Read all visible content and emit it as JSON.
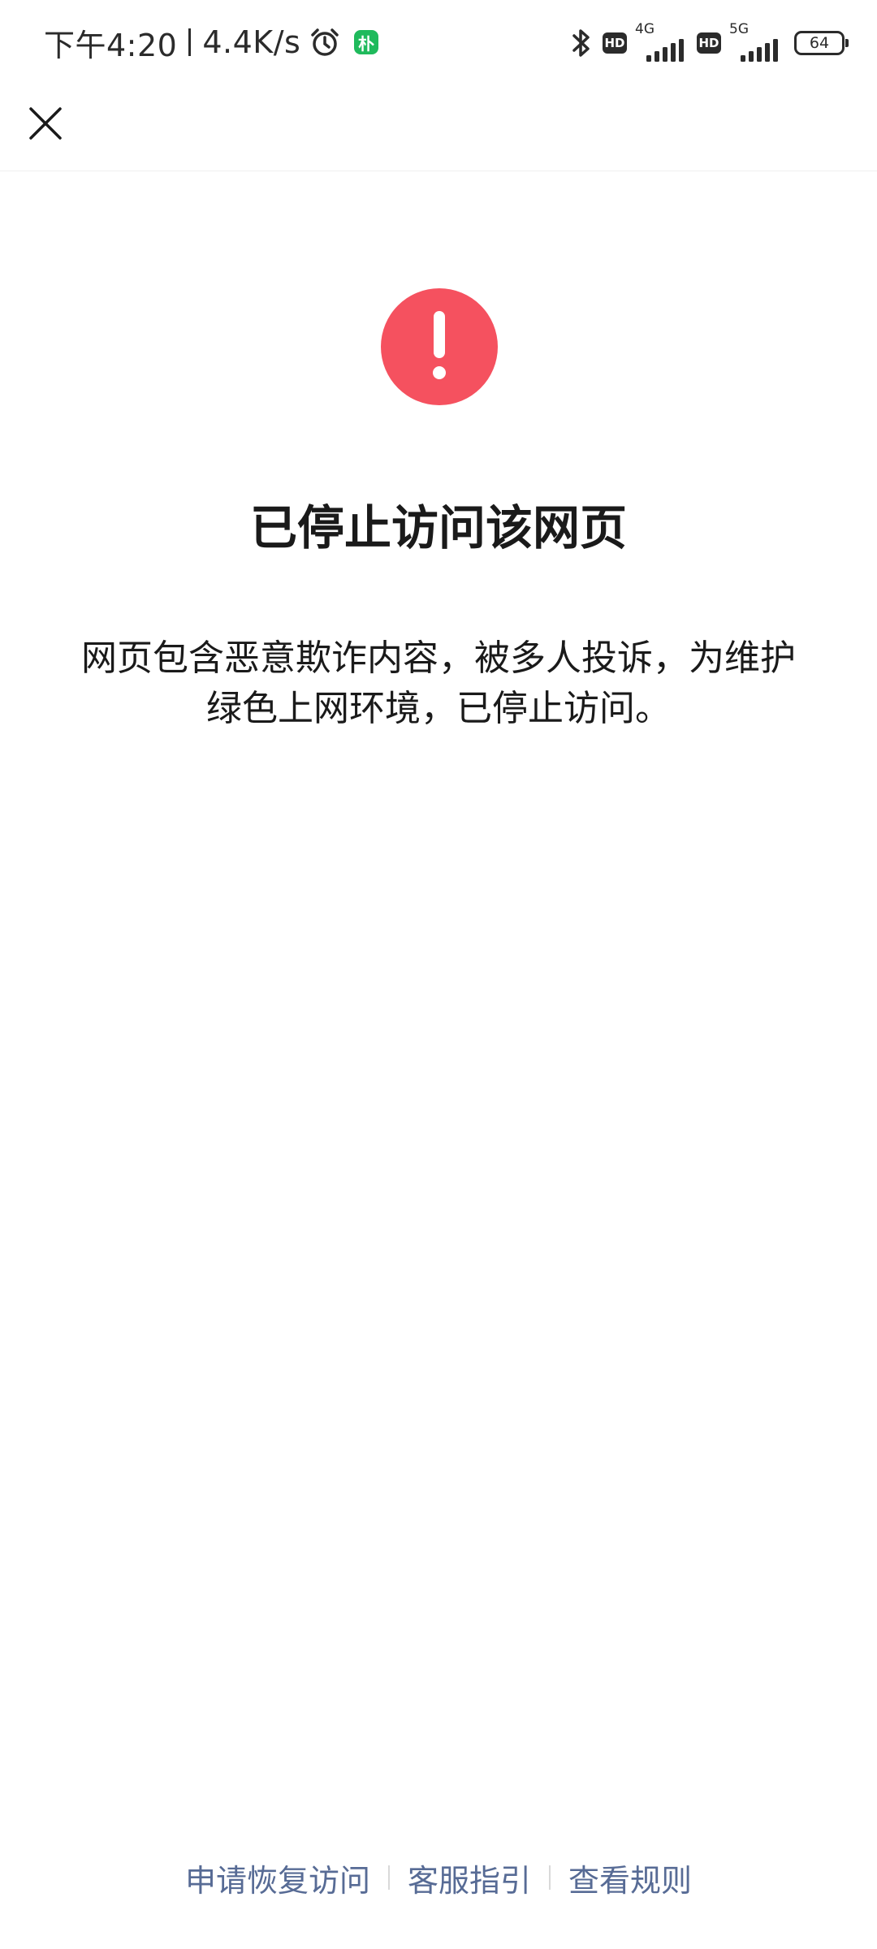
{
  "status_bar": {
    "time": "下午4:20",
    "network_speed": "4.4K/s",
    "app_badge": "朴",
    "hd_label": "HD",
    "network_1": "4G",
    "network_2": "5G",
    "battery": "64"
  },
  "page": {
    "title": "已停止访问该网页",
    "description": "网页包含恶意欺诈内容，被多人投诉，为维护绿色上网环境，已停止访问。"
  },
  "footer": {
    "links": [
      "申请恢复访问",
      "客服指引",
      "查看规则"
    ]
  },
  "colors": {
    "warning": "#f5515f",
    "link": "#576b95",
    "app_badge": "#1fba5c"
  }
}
